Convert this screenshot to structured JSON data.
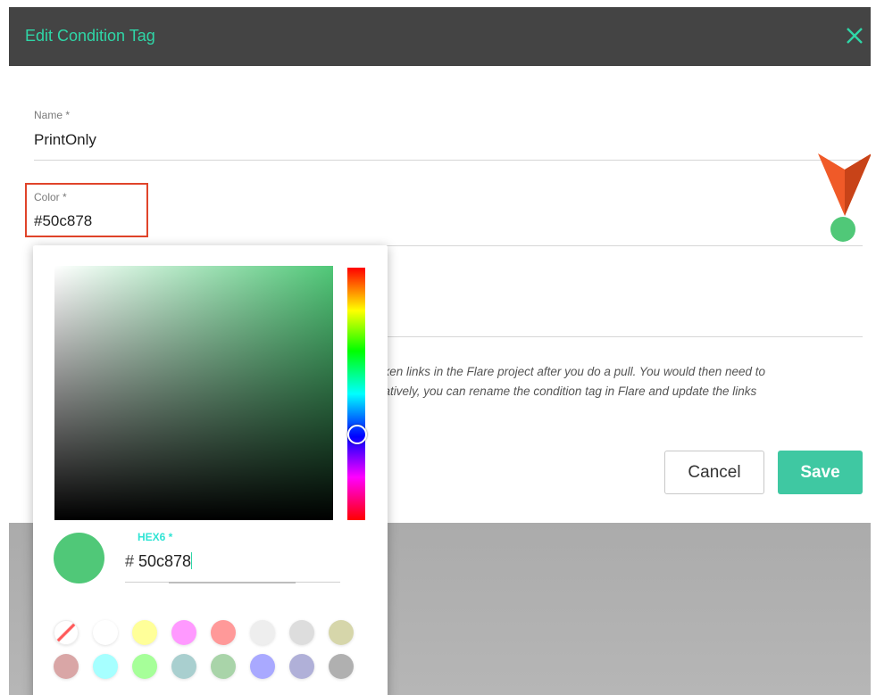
{
  "dialog": {
    "title": "Edit Condition Tag",
    "close_icon": "close-icon"
  },
  "fields": {
    "name_label": "Name *",
    "name_value": "PrintOnly",
    "color_label": "Color *",
    "color_value": "#50c878"
  },
  "info_text": {
    "line1": "oken links in the Flare project after you do a pull. You would then need to",
    "line2": "natively, you can rename the condition tag in Flare and update the links"
  },
  "buttons": {
    "cancel": "Cancel",
    "save": "Save"
  },
  "picker": {
    "hex_label": "HEX6 *",
    "hex_prefix": "#",
    "hex_value": "50c878",
    "selected_color": "#50c878",
    "presets_row1": [
      "none",
      "#ffffff",
      "#ffff99",
      "#ff99ff",
      "#ff9999",
      "#eeeeee",
      "#dddddd",
      "#d6d6aa"
    ],
    "presets_row2": [
      "#d9a6a6",
      "#a6ffff",
      "#a6ff99",
      "#a9cfcf",
      "#a9d4a9",
      "#a9a9ff",
      "#b0b0d8",
      "#b0b0b0"
    ]
  },
  "colors": {
    "header_bg": "#444444",
    "accent": "#2fd6a7",
    "save_bg": "#3fc8a2",
    "highlight_border": "#e0442a",
    "pointer": "#f05a28"
  }
}
